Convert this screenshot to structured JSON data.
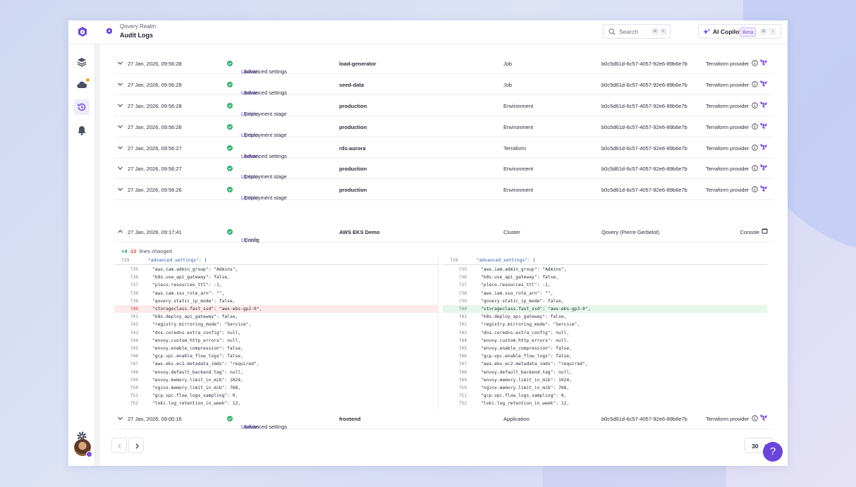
{
  "header": {
    "org_name": "Qovery Realm",
    "page_title": "Audit Logs",
    "search_label": "Search",
    "search_kbd": [
      "⌘",
      "K"
    ],
    "copilot_label": "AI Copilot",
    "copilot_badge": "Beta",
    "copilot_kbd": [
      "⌘",
      "I"
    ]
  },
  "rows": [
    {
      "date": "27 Jan, 2026, 09:56:28",
      "verb": "Update",
      "action": " : Advanced settings",
      "target": "load-generator",
      "type": "Job",
      "id": "b0c5d61d-6c57-4057-92e6-89b6e7b",
      "origin": "Terraform provider"
    },
    {
      "date": "27 Jan, 2026, 09:56:28",
      "verb": "Update",
      "action": " : Advanced settings",
      "target": "seed-data",
      "type": "Job",
      "id": "b0c5d61d-6c57-4057-92e6-89b6e7b",
      "origin": "Terraform provider"
    },
    {
      "date": "27 Jan, 2026, 09:56:28",
      "verb": "Update",
      "action": " : Deployment stage",
      "target": "production",
      "type": "Environment",
      "id": "b0c5d61d-6c57-4057-92e6-89b6e7b",
      "origin": "Terraform provider"
    },
    {
      "date": "27 Jan, 2026, 09:56:28",
      "verb": "Update",
      "action": " : Deployment stage",
      "target": "production",
      "type": "Environment",
      "id": "b0c5d61d-6c57-4057-92e6-89b6e7b",
      "origin": "Terraform provider"
    },
    {
      "date": "27 Jan, 2026, 09:56:27",
      "verb": "Update",
      "action": " : Advanced settings",
      "target": "rds-aurora",
      "type": "Terraform",
      "id": "b0c5d61d-6c57-4057-92e6-89b6e7b",
      "origin": "Terraform provider"
    },
    {
      "date": "27 Jan, 2026, 09:56:27",
      "verb": "Update",
      "action": " : Deployment stage",
      "target": "production",
      "type": "Environment",
      "id": "b0c5d61d-6c57-4057-92e6-89b6e7b",
      "origin": "Terraform provider"
    },
    {
      "date": "27 Jan, 2026, 09:56:26",
      "verb": "Update",
      "action": " : Deployment stage",
      "target": "production",
      "type": "Environment",
      "id": "b0c5d61d-6c57-4057-92e6-89b6e7b",
      "origin": "Terraform provider"
    }
  ],
  "expanded_row": {
    "date": "27 Jan, 2026, 09:17:41",
    "verb": "Update",
    "action": " : Config",
    "target": "AWS EKS Demo",
    "type": "Cluster",
    "user": "Qovery (Pierre Gerbelot)",
    "origin": "Console"
  },
  "diff": {
    "added": "+4",
    "removed": "-10",
    "summary": "lines changed",
    "header_line": "729",
    "header_text": "\"advanced_settings\": {",
    "left_lines": [
      {
        "n": "735",
        "t": "\"aws.iam.admin_group\": \"Admins\","
      },
      {
        "n": "736",
        "t": "\"k8s.use_api_gateway\": false,"
      },
      {
        "n": "737",
        "t": "\"pleco.resources_ttl\": -1,"
      },
      {
        "n": "738",
        "t": "\"aws.iam.sso_role_arn\": \"\","
      },
      {
        "n": "739",
        "t": "\"qovery.static_ip_mode\": false,"
      },
      {
        "n": "740",
        "t": "\"storageclass.fast_ssd\": \"aws-ebs-gp2-0\","
      },
      {
        "n": "741",
        "t": "\"k8s.deploy_api_gateway\": false,"
      },
      {
        "n": "742",
        "t": "\"registry.mirroring_mode\": \"Service\","
      },
      {
        "n": "743",
        "t": "\"dns.coredns.extra_config\": null,"
      },
      {
        "n": "744",
        "t": "\"envoy.custom_http_errors\": null,"
      },
      {
        "n": "745",
        "t": "\"envoy.enable_compression\": false,"
      },
      {
        "n": "746",
        "t": "\"gcp.vpc.enable_flow_logs\": false,"
      },
      {
        "n": "747",
        "t": "\"aws.eks.ec2.metadata_imds\": \"required\","
      },
      {
        "n": "748",
        "t": "\"envoy.default_backend.tag\": null,"
      },
      {
        "n": "749",
        "t": "\"envoy.memory.limit_in_mib\": 1024,"
      },
      {
        "n": "750",
        "t": "\"nginx.memory.limit_in_mib\": 768,"
      },
      {
        "n": "751",
        "t": "\"gcp.vpc.flow_logs_sampling\": 0,"
      },
      {
        "n": "752",
        "t": "\"loki.log_retention_in_week\": 12,"
      }
    ],
    "right_lines": [
      {
        "n": "735",
        "t": "\"aws.iam.admin_group\": \"Admins\","
      },
      {
        "n": "736",
        "t": "\"k8s.use_api_gateway\": false,"
      },
      {
        "n": "737",
        "t": "\"pleco.resources_ttl\": -1,"
      },
      {
        "n": "738",
        "t": "\"aws.iam.sso_role_arn\": \"\","
      },
      {
        "n": "739",
        "t": "\"qovery.static_ip_mode\": false,"
      },
      {
        "n": "740",
        "t": "\"storageclass.fast_ssd\": \"aws-ebs-gp3-0\","
      },
      {
        "n": "741",
        "t": "\"k8s.deploy_api_gateway\": false,"
      },
      {
        "n": "742",
        "t": "\"registry.mirroring_mode\": \"Service\","
      },
      {
        "n": "743",
        "t": "\"dns.coredns.extra_config\": null,"
      },
      {
        "n": "744",
        "t": "\"envoy.custom_http_errors\": null,"
      },
      {
        "n": "745",
        "t": "\"envoy.enable_compression\": false,"
      },
      {
        "n": "746",
        "t": "\"gcp.vpc.enable_flow_logs\": false,"
      },
      {
        "n": "747",
        "t": "\"aws.eks.ec2.metadata_imds\": \"required\","
      },
      {
        "n": "748",
        "t": "\"envoy.default_backend.tag\": null,"
      },
      {
        "n": "749",
        "t": "\"envoy.memory.limit_in_mib\": 1024,"
      },
      {
        "n": "750",
        "t": "\"nginx.memory.limit_in_mib\": 768,"
      },
      {
        "n": "751",
        "t": "\"gcp.vpc.flow_logs_sampling\": 0,"
      },
      {
        "n": "752",
        "t": "\"loki.log_retention_in_week\": 12,"
      }
    ]
  },
  "last_row": {
    "date": "27 Jan, 2026, 09:00:16",
    "verb": "Update",
    "action": " : Advanced settings",
    "target": "frontend",
    "type": "Application",
    "id": "b0c5d61d-6c57-4057-92e6-89b6e7b",
    "origin": "Terraform provider"
  },
  "pagination": {
    "per_page": "30"
  },
  "help_label": "?",
  "colors": {
    "accent": "#7a4cd8",
    "success": "#34b36a",
    "deleted": "#fdeaea",
    "added": "#e6f6ea"
  }
}
